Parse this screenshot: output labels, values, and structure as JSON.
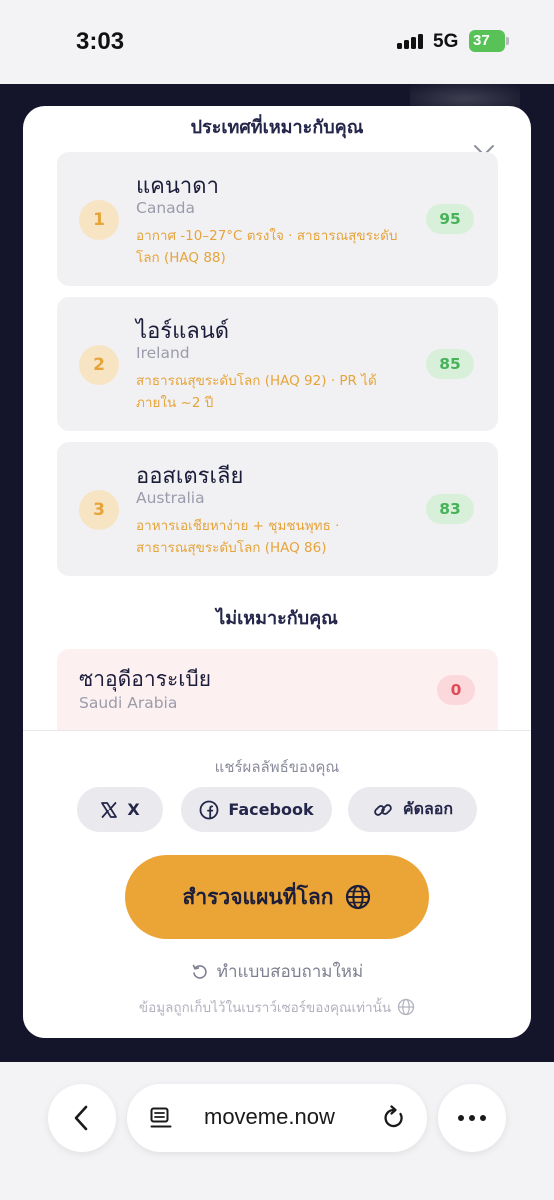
{
  "status_bar": {
    "time": "3:03",
    "network": "5G",
    "battery": "37"
  },
  "modal": {
    "title": "ประเทศที่เหมาะกับคุณ",
    "top_matches": [
      {
        "rank": "1",
        "name_th": "แคนาดา",
        "name_en": "Canada",
        "reason": "อากาศ -10–27°C ตรงใจ · สาธารณสุขระดับโลก (HAQ 88)",
        "score": "95"
      },
      {
        "rank": "2",
        "name_th": "ไอร์แลนด์",
        "name_en": "Ireland",
        "reason": "สาธารณสุขระดับโลก (HAQ 92) · PR ได้ภายใน ~2 ปี",
        "score": "85"
      },
      {
        "rank": "3",
        "name_th": "ออสเตรเลีย",
        "name_en": "Australia",
        "reason": "อาหารเอเชียหาง่าย + ชุมชนพุทธ · สาธารณสุขระดับโลก (HAQ 86)",
        "score": "83"
      }
    ],
    "not_suitable_title": "ไม่เหมาะกับคุณ",
    "not_suitable": [
      {
        "name_th": "ซาอุดีอาระเบีย",
        "name_en": "Saudi Arabia",
        "score": "0"
      }
    ],
    "share": {
      "label": "แชร์ผลลัพธ์ของคุณ",
      "x_label": "X",
      "facebook_label": "Facebook",
      "copy_label": "คัดลอก"
    },
    "explore_label": "สำรวจแผนที่โลก",
    "retake_label": "ทำแบบสอบถามใหม่",
    "privacy_note": "ข้อมูลถูกเก็บไว้ในเบราว์เซอร์ของคุณเท่านั้น"
  },
  "browser": {
    "url": "moveme.now"
  },
  "colors": {
    "accent": "#eba537",
    "rank_text": "#e6a43a",
    "score_good_bg": "#d8f0da",
    "score_good_text": "#47b25a",
    "score_bad_bg": "#fbd8db",
    "score_bad_text": "#de4d57",
    "backdrop": "#14142a"
  }
}
